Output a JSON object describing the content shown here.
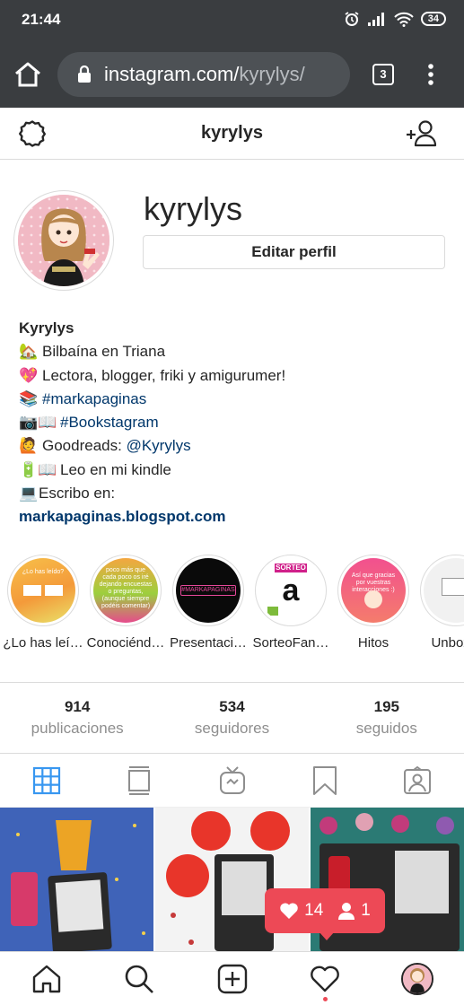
{
  "status_bar": {
    "time": "21:44",
    "battery": "34"
  },
  "browser": {
    "url_domain": "instagram.com/",
    "url_path": "kyrylys/",
    "tab_count": "3"
  },
  "header": {
    "username": "kyrylys"
  },
  "profile": {
    "username": "kyrylys",
    "edit_button": "Editar perfil"
  },
  "bio": {
    "name": "Kyrylys",
    "line1": {
      "emoji": "🏡",
      "text": "Bilbaína en Triana"
    },
    "line2": {
      "emoji": "💖",
      "text": "Lectora, blogger, friki y amigurumer!"
    },
    "line3": {
      "emoji": "📚",
      "hashtag": "#markapaginas"
    },
    "line4": {
      "emoji": "📷📖",
      "hashtag": "#Bookstagram"
    },
    "line5": {
      "emoji": "🙋",
      "text": "Goodreads: ",
      "mention": "@Kyrylys"
    },
    "line6": {
      "emoji": "🔋📖",
      "text": "Leo en mi kindle"
    },
    "line7": {
      "emoji": "💻",
      "text": "Escribo en:"
    },
    "link": "markapaginas.blogspot.com"
  },
  "highlights": [
    {
      "label": "¿Lo has leí…",
      "text": "¿Lo has leído?"
    },
    {
      "label": "Conociénd…",
      "text": "poco más que cada poco os iré dejando encuestas o preguntas, (aunque siempre podéis comentar)"
    },
    {
      "label": "Presentaci…",
      "text": "#MARKAPAGINAS"
    },
    {
      "label": "SorteoFan…",
      "text": "SORTEO"
    },
    {
      "label": "Hitos",
      "text": "Así que gracias por vuestras interacciones :)"
    },
    {
      "label": "Unboxin"
    }
  ],
  "stats": [
    {
      "value": "914",
      "label": "publicaciones"
    },
    {
      "value": "534",
      "label": "seguidores"
    },
    {
      "value": "195",
      "label": "seguidos"
    }
  ],
  "notification": {
    "likes": "14",
    "followers": "1"
  },
  "colors": {
    "accent": "#ed4956",
    "link": "#00376b",
    "grid_active": "#3897f0",
    "chrome": "#3a3d40"
  }
}
